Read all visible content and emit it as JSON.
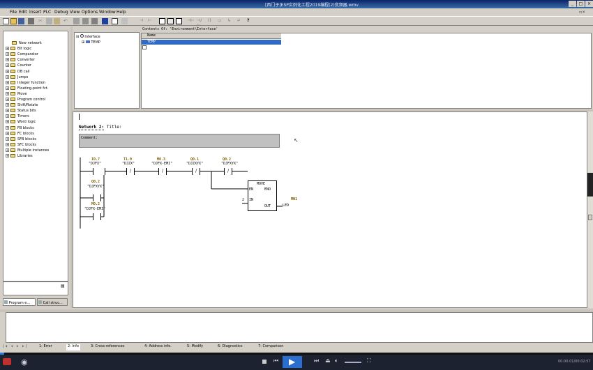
{
  "window": {
    "title": "[西门子]ESP实例化工程2019编程(2)变频器.wmv"
  },
  "menu": [
    "File",
    "Edit",
    "Insert",
    "PLC",
    "Debug",
    "View",
    "Options",
    "Window",
    "Help"
  ],
  "interface_tree": {
    "root": "Interface",
    "child": "TEMP"
  },
  "contents": {
    "header": "Contents Of: 'Environment\\Interface'",
    "col_name": "Name",
    "row1": "TEMP"
  },
  "network": {
    "label": "Network 2:",
    "title_label": "Title:",
    "comment_label": "Comment:"
  },
  "ladder": {
    "c1_addr": "I0.7",
    "c1_name": "\"DJFX\"",
    "c2_addr": "T1.0",
    "c2_name": "\"DJZX\"",
    "c3_addr": "M0.3",
    "c3_name": "\"DJFX-EMI\"",
    "c4_addr": "Q0.1",
    "c4_name": "\"DJZXYX\"",
    "c5_addr": "Q0.2",
    "c5_name": "\"DJFXYX\"",
    "p1_addr": "Q0.2",
    "p1_name": "\"DJFXYX\"",
    "p2_addr": "M0.2",
    "p2_name": "\"DJFX-EMI\"",
    "move_title": "MOVE",
    "move_en": "EN",
    "move_eno": "ENO",
    "move_in": "IN",
    "move_out": "OUT",
    "in_value": "2",
    "out_addr": "MW1",
    "out_name": "LED"
  },
  "catalog": [
    "New network",
    "Bit logic",
    "Comparator",
    "Converter",
    "Counter",
    "DB call",
    "Jumps",
    "Integer function",
    "Floating-point fct.",
    "Move",
    "Program control",
    "Shift/Rotate",
    "Status bits",
    "Timers",
    "Word logic",
    "FB blocks",
    "FC blocks",
    "SFB blocks",
    "SFC blocks",
    "Multiple instances",
    "Libraries"
  ],
  "left_tabs": {
    "program": "Program e...",
    "call": "Call struc..."
  },
  "bottom_tabs": [
    "1: Error",
    "2: Info",
    "3: Cross-references",
    "4: Address info.",
    "5: Modify",
    "6: Diagnostics",
    "7: Comparison"
  ],
  "player": {
    "time": "00:00:01/00:02:57"
  }
}
